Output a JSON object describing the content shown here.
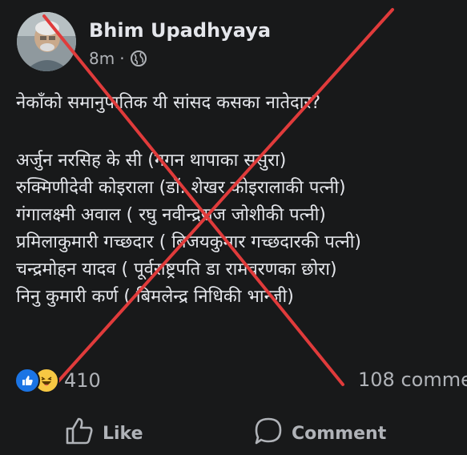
{
  "post": {
    "author": "Bhim Upadhyaya",
    "time": "8m",
    "separator": "·",
    "privacy_icon": "globe-icon",
    "lines": [
      "नेकाँको समानुपातिक यी सांसद कसका नातेदार?",
      "अर्जुन नरसिह के सी (गगन थापाका ससुरा)",
      "रुक्मिणीदेवी कोइराला (डॉ. शेखर कोइरालाकी पत्नी)",
      "गंगालक्ष्मी अवाल ( रघु नवीन्द्रराज जोशीकी पत्नी)",
      "प्रमिलाकुमारी गच्छदार ( बिजयकुमार गच्छदारकी पत्नी)",
      "चन्द्रमोहन यादव ( पूर्वराष्ट्रपति डा रामवरणका छोरा)",
      "निनु कुमारी कर्ण ( बिमलेन्द्र निधिकी भान्जी)"
    ]
  },
  "reactions": {
    "count": "410",
    "icons": [
      "like-reaction-icon",
      "haha-reaction-icon"
    ]
  },
  "comments": {
    "label": "108 comme"
  },
  "actions": {
    "like": "Like",
    "comment": "Comment"
  },
  "colors": {
    "cross": "#e03b3b",
    "like_blue": "#1b74e4",
    "haha_yellow": "#f7c843"
  }
}
